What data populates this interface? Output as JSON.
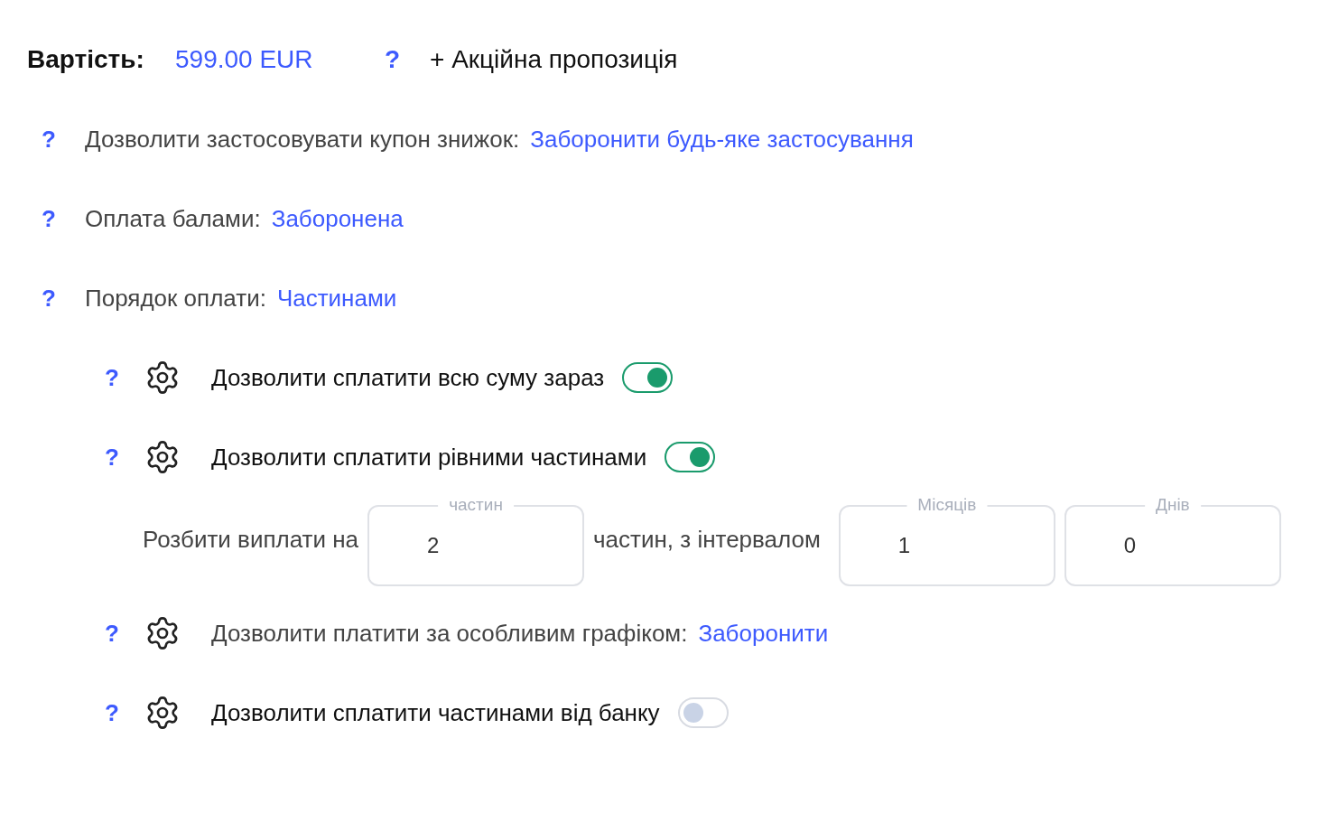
{
  "price": {
    "label": "Вартість:",
    "value": "599.00 EUR",
    "help": "?",
    "promo": "+ Акційна пропозиція"
  },
  "settings": [
    {
      "help": "?",
      "label": "Дозволити застосовувати купон знижок:",
      "value": "Заборонити будь-яке застосування"
    },
    {
      "help": "?",
      "label": "Оплата балами:",
      "value": "Заборонена"
    },
    {
      "help": "?",
      "label": "Порядок оплати:",
      "value": "Частинами"
    }
  ],
  "options": [
    {
      "kind": "toggle",
      "help": "?",
      "label": "Дозволити сплатити всю суму зараз",
      "on": true
    },
    {
      "kind": "toggle",
      "help": "?",
      "label": "Дозволити сплатити рівними частинами",
      "on": true
    },
    {
      "kind": "split",
      "label": "Розбити виплати на",
      "middle": "частин, з інтервалом",
      "parts": {
        "label": "частин",
        "value": "2"
      },
      "interval": [
        {
          "label": "Місяців",
          "value": "1"
        },
        {
          "label": "Днів",
          "value": "0"
        }
      ]
    },
    {
      "kind": "link",
      "help": "?",
      "label": "Дозволити платити за особливим графіком:",
      "value": "Заборонити"
    },
    {
      "kind": "toggle",
      "help": "?",
      "label": "Дозволити сплатити частинами від банку",
      "on": false
    }
  ]
}
